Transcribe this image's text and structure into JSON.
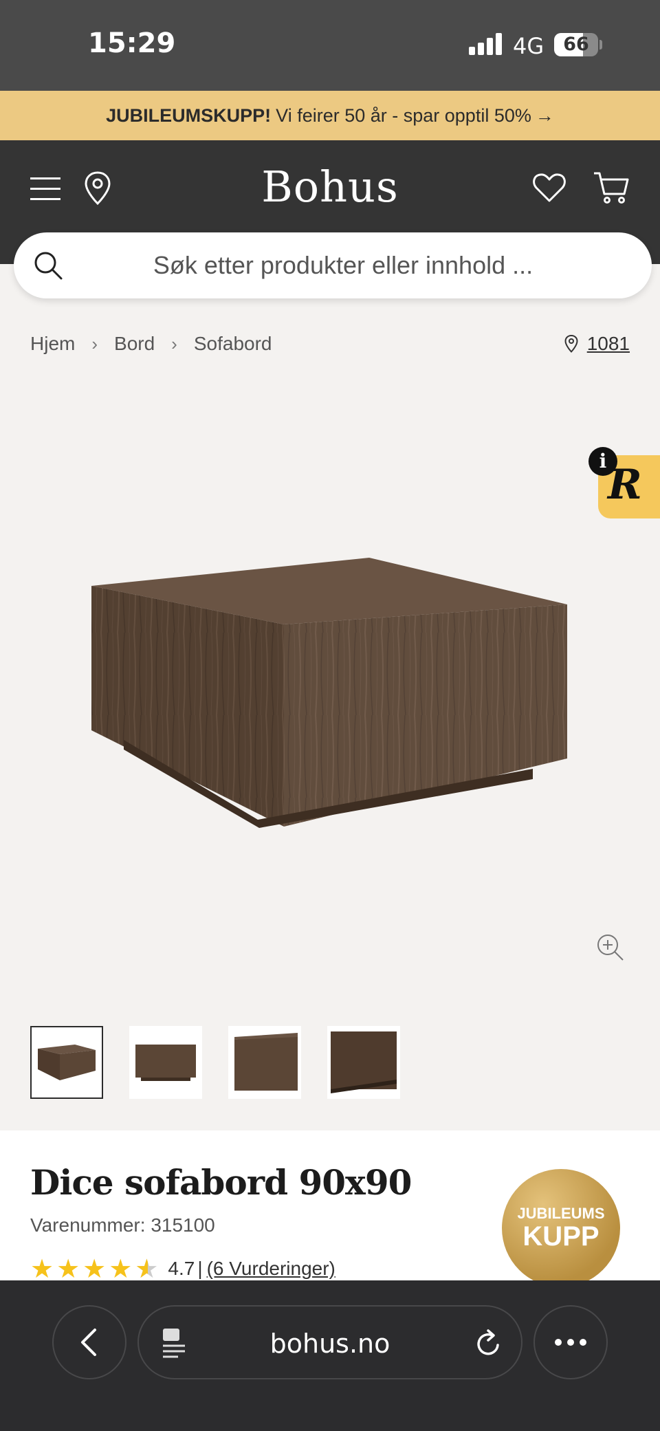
{
  "status_bar": {
    "time": "15:29",
    "network": "4G",
    "battery": "66"
  },
  "promo": {
    "bold": "JUBILEUMSKUPP!",
    "text": "Vi feirer 50 år - spar opptil 50%",
    "arrow": "→"
  },
  "header": {
    "logo": "Bohus"
  },
  "search": {
    "placeholder": "Søk etter produkter eller innhold ..."
  },
  "breadcrumb": {
    "items": [
      "Hjem",
      "Bord",
      "Sofabord"
    ],
    "separator": "›"
  },
  "store": {
    "number": "1081"
  },
  "retailer_badge": {
    "letter": "R",
    "info": "i"
  },
  "product": {
    "title": "Dice sofabord 90x90",
    "sku": "Varenummer: 315100",
    "rating_value": "4.7",
    "rating_divider": "|",
    "reviews": "(6 Vurderinger)",
    "stars": 4.5,
    "thumbnail_count": 4
  },
  "badge": {
    "line1": "JUBILEUMS",
    "line2": "KUPP"
  },
  "browser": {
    "url": "bohus.no"
  },
  "colors": {
    "accent": "#ecc982",
    "header": "#343434",
    "star": "#f6c21b",
    "wood": "#5a4535"
  }
}
